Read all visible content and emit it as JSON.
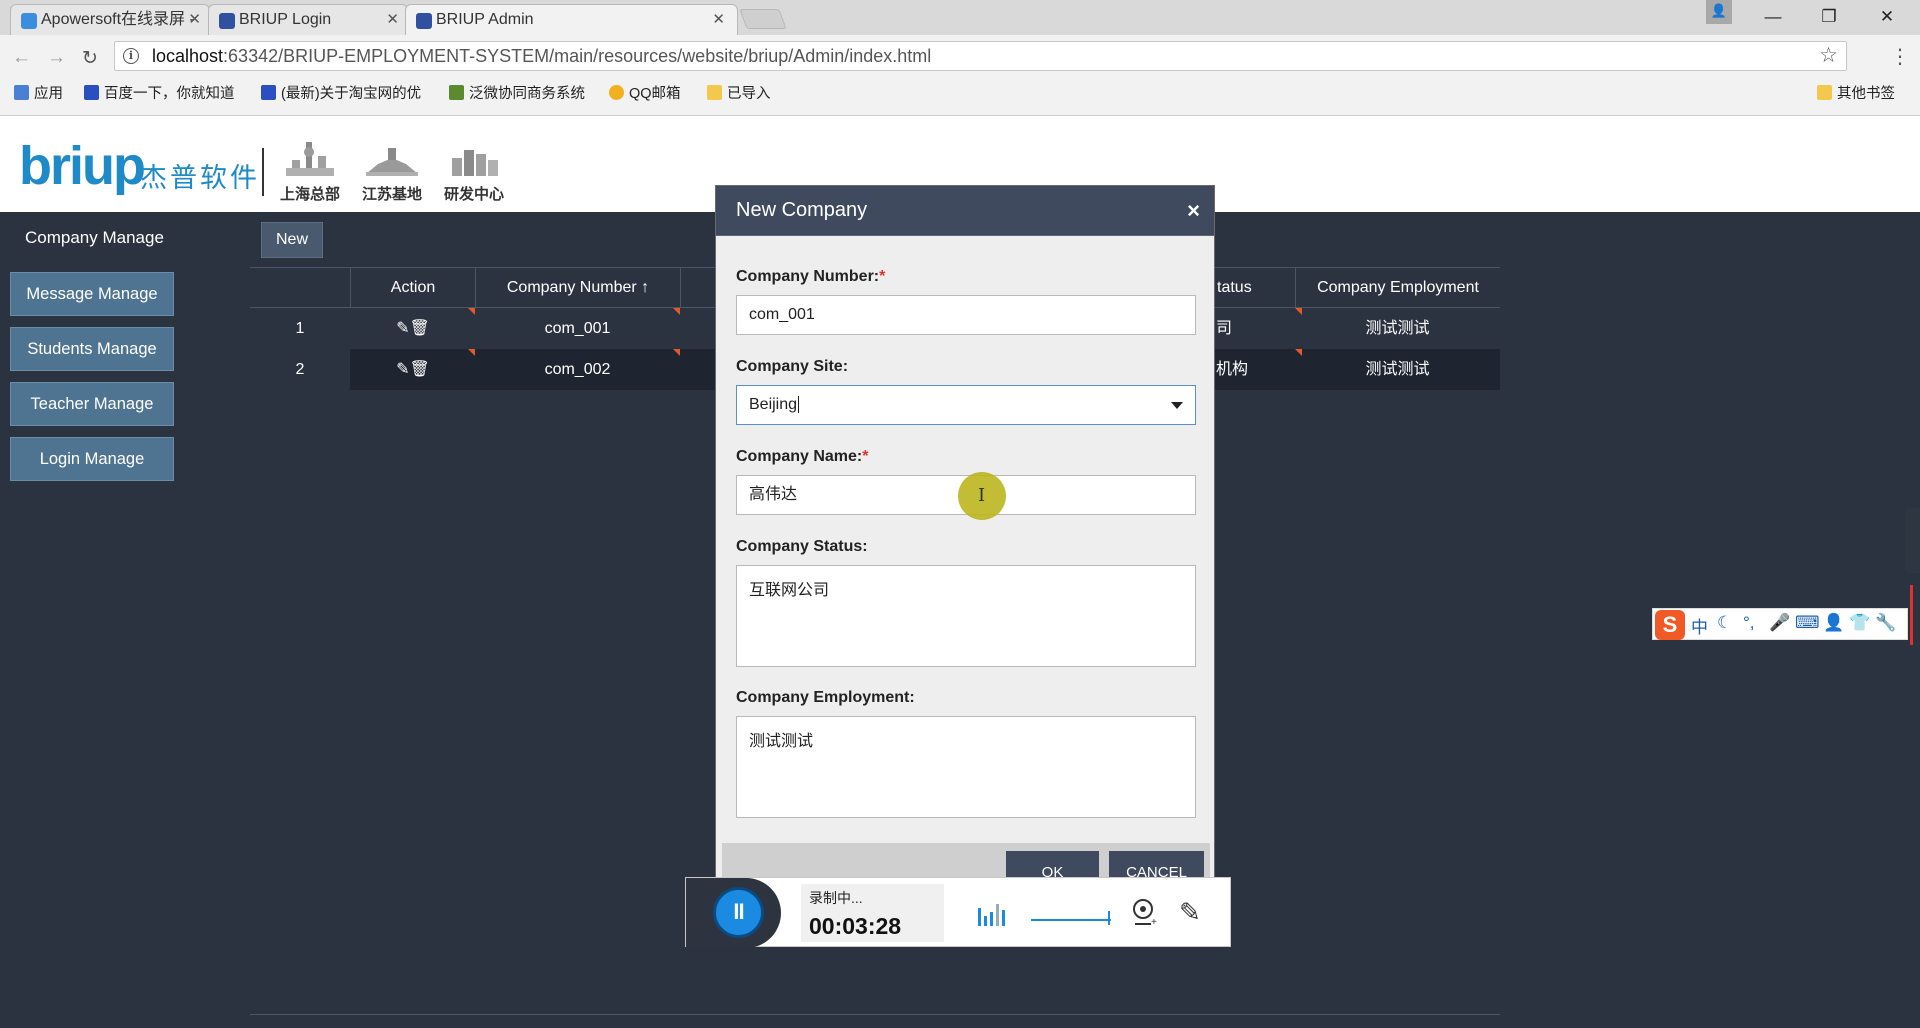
{
  "browser": {
    "tabs": [
      {
        "title": "Apowersoft在线录屏 - ",
        "color": "#3b8ede"
      },
      {
        "title": "BRIUP Login",
        "color": "#3050a0"
      },
      {
        "title": "BRIUP Admin",
        "color": "#3050a0",
        "active": true
      }
    ],
    "window_controls": {
      "minimize": "—",
      "restore": "❐",
      "close": "✕"
    },
    "url_host": "localhost",
    "url_rest": ":63342/BRIUP-EMPLOYMENT-SYSTEM/main/resources/website/briup/Admin/index.html",
    "bookmarks": [
      {
        "label": "应用",
        "color": "#4a7fd4"
      },
      {
        "label": "百度一下，你就知道",
        "color": "#2b4fc0"
      },
      {
        "label": "(最新)关于淘宝网的优",
        "color": "#2b4fc0"
      },
      {
        "label": "泛微协同商务系统",
        "color": "#5c8a2e"
      },
      {
        "label": "QQ邮箱",
        "color": "#f0b020"
      },
      {
        "label": "已导入",
        "color": "#f2c94c"
      }
    ],
    "other_bookmarks": "其他书签"
  },
  "header": {
    "logo": "briup",
    "logo_cn": "杰普软件",
    "branches": [
      "上海总部",
      "江苏基地",
      "研发中心"
    ]
  },
  "sidebar": {
    "title": "Company Manage",
    "items": [
      "Message Manage",
      "Students Manage",
      "Teacher Manage",
      "Login Manage"
    ]
  },
  "content": {
    "new_button": "New",
    "table": {
      "columns": [
        "Action",
        "Company Number",
        "tatus",
        "Company Employment"
      ],
      "sort_icon": "↑",
      "rows": [
        {
          "index": "1",
          "number": "com_001",
          "status": "司",
          "employment": "测试测试"
        },
        {
          "index": "2",
          "number": "com_002",
          "status": "机构",
          "employment": "测试测试"
        }
      ]
    }
  },
  "modal": {
    "title": "New Company",
    "close": "×",
    "fields": {
      "number_label": "Company Number:",
      "number_value": "com_001",
      "site_label": "Company Site:",
      "site_value": "Beijing",
      "name_label": "Company Name:",
      "name_value": "高伟达",
      "status_label": "Company Status:",
      "status_value": "互联网公司",
      "employment_label": "Company Employment:",
      "employment_value": "测试测试"
    },
    "required_mark": "*",
    "ok": "OK",
    "cancel": "CANCEL"
  },
  "recorder": {
    "status": "录制中...",
    "time": "00:03:28"
  },
  "ime": {
    "logo": "S",
    "mode": "中"
  }
}
